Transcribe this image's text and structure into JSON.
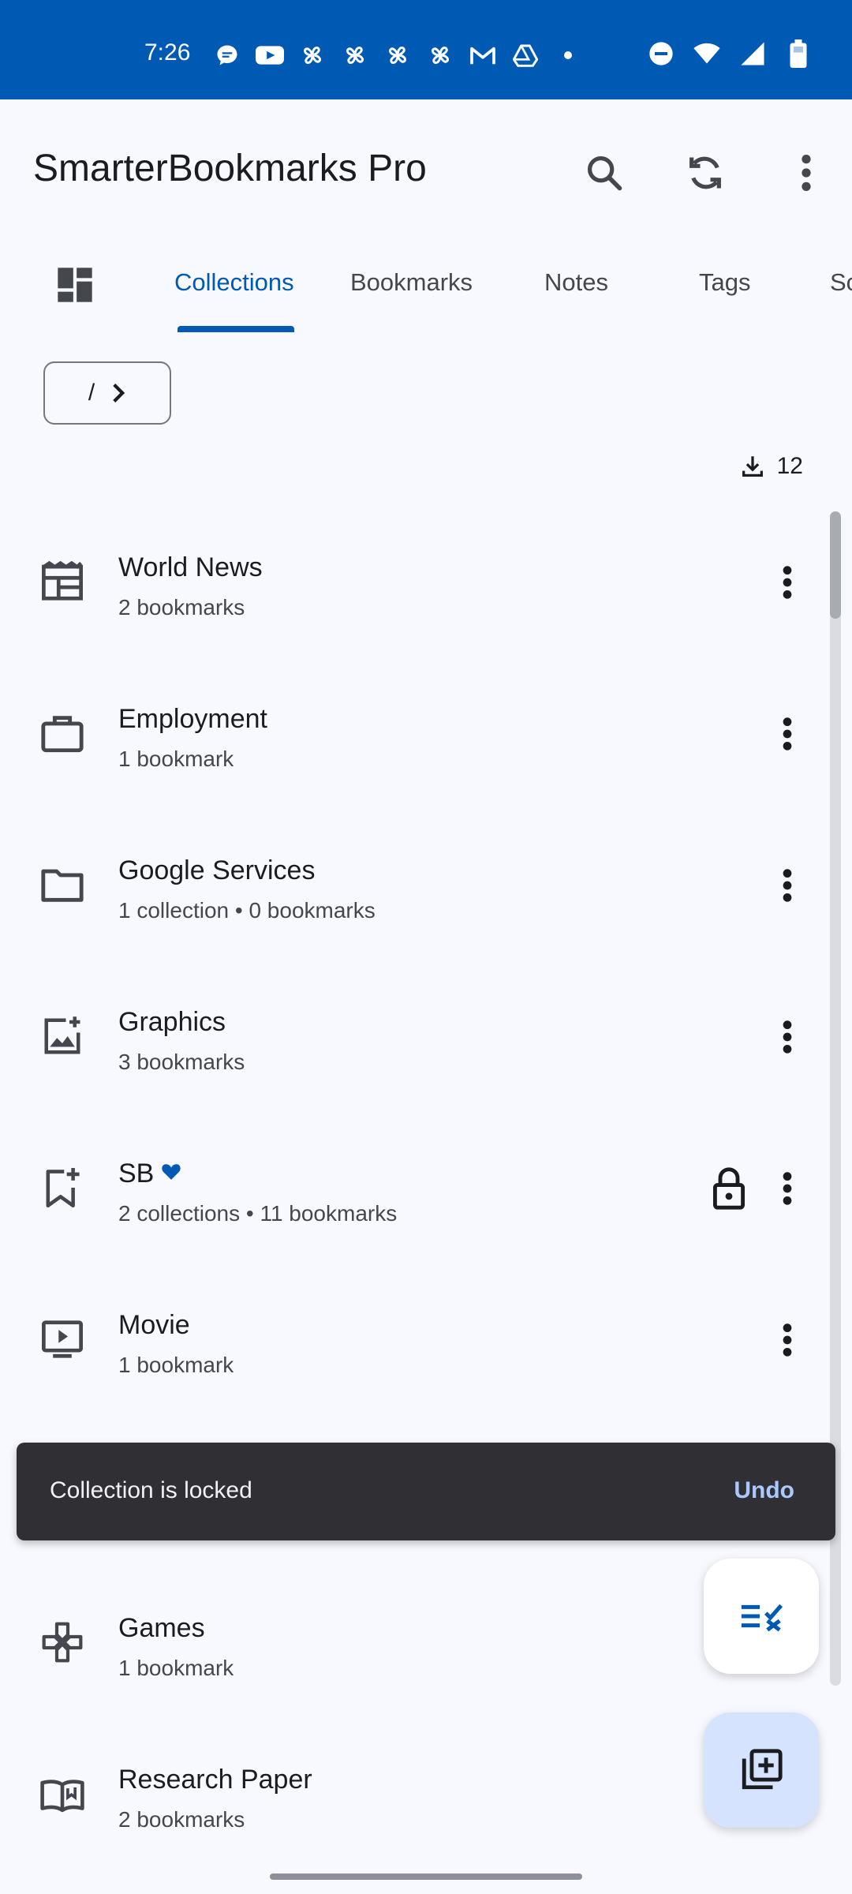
{
  "status_bar": {
    "time": "7:26",
    "icons": [
      "messages-icon",
      "youtube-icon",
      "pinwheel-icon",
      "pinwheel-icon",
      "pinwheel-icon",
      "pinwheel-icon",
      "gmail-icon",
      "drive-icon",
      "dot-icon"
    ],
    "right_icons": [
      "dnd-icon",
      "wifi-icon",
      "signal-icon",
      "battery-icon"
    ]
  },
  "app_bar": {
    "title": "SmarterBookmarks Pro",
    "actions": [
      "search-icon",
      "sync-icon",
      "more-vert-icon"
    ]
  },
  "tabs": {
    "items": [
      {
        "label": "Collections",
        "active": true
      },
      {
        "label": "Bookmarks",
        "active": false
      },
      {
        "label": "Notes",
        "active": false
      },
      {
        "label": "Tags",
        "active": false
      },
      {
        "label": "Sc",
        "active": false
      }
    ]
  },
  "breadcrumb": {
    "root": "/"
  },
  "count": {
    "value": "12",
    "icon": "download-icon"
  },
  "collections": [
    {
      "title": "World News",
      "subtitle": "2 bookmarks",
      "icon": "newspaper-icon"
    },
    {
      "title": "Employment",
      "subtitle": "1 bookmark",
      "icon": "briefcase-icon"
    },
    {
      "title": "Google Services",
      "subtitle": "1 collection • 0 bookmarks",
      "icon": "folder-icon"
    },
    {
      "title": "Graphics",
      "subtitle": "3 bookmarks",
      "icon": "add-photo-icon"
    },
    {
      "title": "SB",
      "subtitle": "2 collections • 11 bookmarks",
      "icon": "bookmark-add-icon",
      "locked": true,
      "favorite": true
    },
    {
      "title": "Movie",
      "subtitle": "1 bookmark",
      "icon": "play-icon"
    },
    {
      "title": "",
      "subtitle": "",
      "icon": ""
    },
    {
      "title": "Games",
      "subtitle": "1 bookmark",
      "icon": "gamepad-icon"
    },
    {
      "title": "Research Paper",
      "subtitle": "2 bookmarks",
      "icon": "book-icon"
    }
  ],
  "snackbar": {
    "message": "Collection is locked",
    "action": "Undo"
  },
  "fabs": {
    "small_icon": "checklist-icon",
    "main_icon": "library-add-icon"
  },
  "colors": {
    "primary": "#0059B3",
    "surface": "#F8F9FE",
    "snackbar": "#303034",
    "fab_main": "#D6E3FF"
  }
}
